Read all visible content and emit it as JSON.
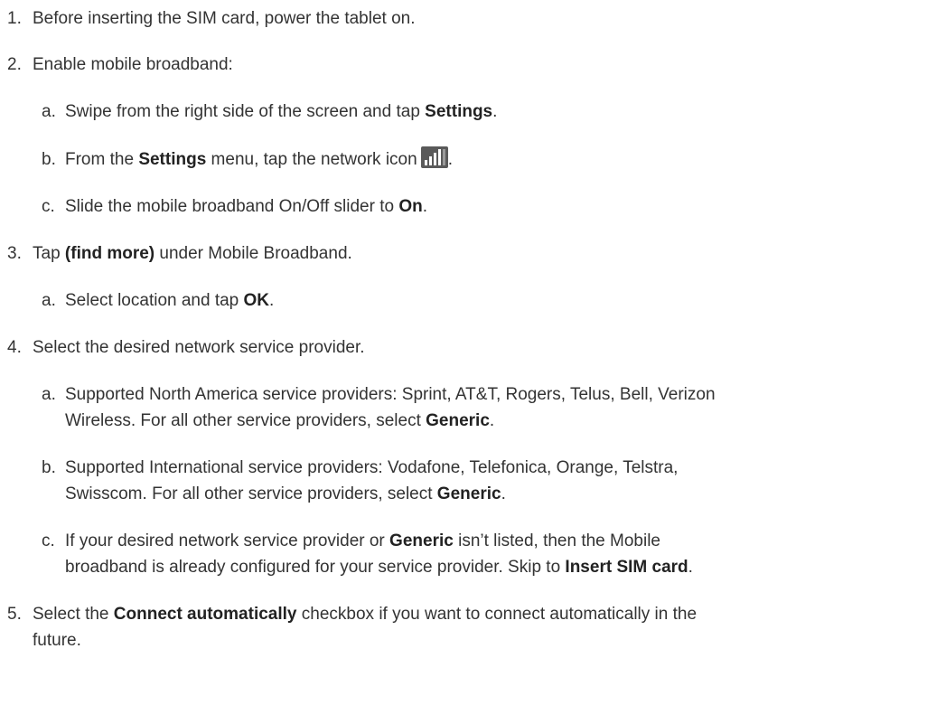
{
  "steps": [
    {
      "num": "1.",
      "text": "Before inserting the SIM card, power the tablet on."
    },
    {
      "num": "2.",
      "text": "Enable mobile broadband:",
      "sub": [
        {
          "num": "a.",
          "pre": "Swipe from the right side of the screen and tap ",
          "bold": "Settings",
          "post": "."
        },
        {
          "num": "b.",
          "pre": "From the ",
          "bold": "Settings",
          "mid": " menu, tap the network icon",
          "post": "."
        },
        {
          "num": "c.",
          "pre": "Slide the mobile broadband On/Off slider to ",
          "bold": "On",
          "post": "."
        }
      ]
    },
    {
      "num": "3.",
      "pre": "Tap ",
      "bold": "(find more)",
      "post": " under Mobile Broadband.",
      "sub": [
        {
          "num": "a.",
          "pre": "Select location and tap ",
          "bold": "OK",
          "post": "."
        }
      ]
    },
    {
      "num": "4.",
      "text": "Select the desired network service provider.",
      "sub": [
        {
          "num": "a.",
          "line1": "Supported North America service providers: Sprint, AT&T, Rogers, Telus, Bell, Verizon",
          "line2_pre": "Wireless. For all other service providers, select ",
          "bold": "Generic",
          "post": "."
        },
        {
          "num": "b.",
          "line1": "Supported International service providers: Vodafone, Telefonica, Orange, Telstra,",
          "line2_pre": "Swisscom. For all other service providers, select ",
          "bold": "Generic",
          "post": "."
        },
        {
          "num": "c.",
          "line1_pre": "If your desired network service provider or ",
          "line1_bold": "Generic",
          "line1_post": " isn’t listed, then the Mobile",
          "line2_pre": "broadband is already configured for your service provider. Skip to ",
          "bold": "Insert SIM card",
          "post": "."
        }
      ]
    },
    {
      "num": "5.",
      "pre": "Select the ",
      "bold": "Connect automatically",
      "post": " checkbox if you want to connect automatically in the",
      "line2": "future."
    }
  ],
  "icons": {
    "network": "network-signal-icon"
  },
  "colors": {
    "text": "#333333",
    "icon_bg": "#5a5a5a",
    "icon_bars": "#ffffff"
  }
}
